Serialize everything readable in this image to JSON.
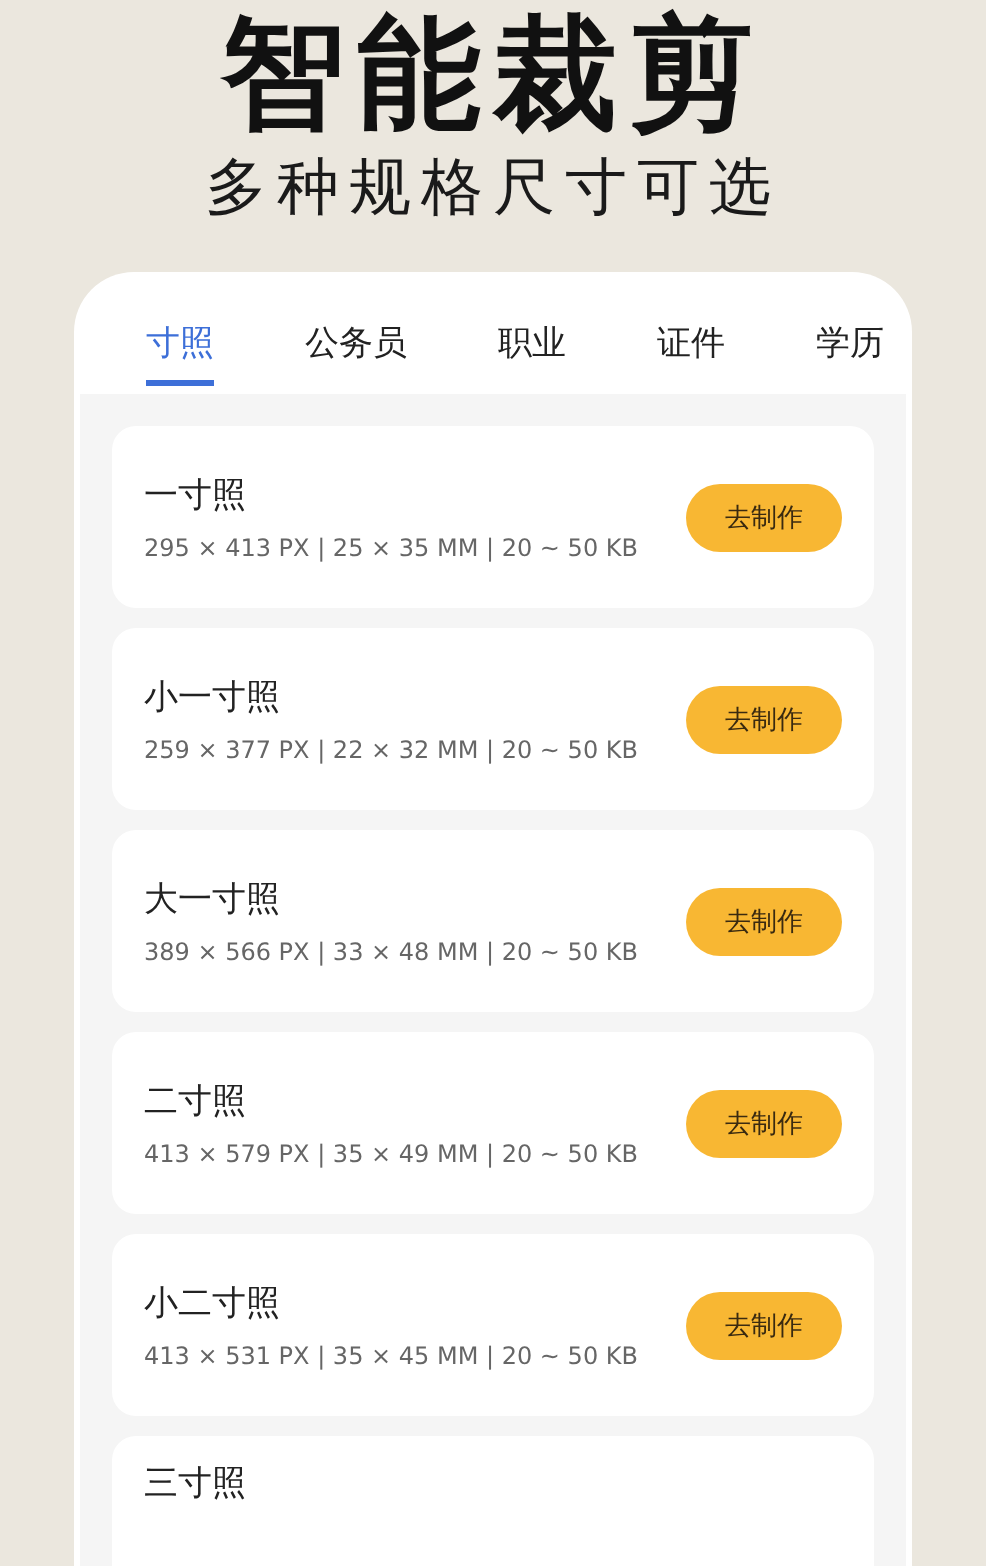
{
  "headline": "智能裁剪",
  "subheadline": "多种规格尺寸可选",
  "tabs": [
    {
      "label": "寸照",
      "selected": true
    },
    {
      "label": "公务员",
      "selected": false
    },
    {
      "label": "职业",
      "selected": false
    },
    {
      "label": "证件",
      "selected": false
    },
    {
      "label": "学历",
      "selected": false
    }
  ],
  "sizes": [
    {
      "name": "一寸照",
      "spec": "295 × 413 PX | 25 × 35 MM | 20 ~ 50 KB",
      "button": "去制作"
    },
    {
      "name": "小一寸照",
      "spec": "259 × 377 PX | 22 × 32 MM | 20 ~ 50 KB",
      "button": "去制作"
    },
    {
      "name": "大一寸照",
      "spec": "389 × 566 PX | 33 × 48 MM | 20 ~ 50 KB",
      "button": "去制作"
    },
    {
      "name": "二寸照",
      "spec": "413 × 579 PX | 35 × 49 MM | 20 ~ 50 KB",
      "button": "去制作"
    },
    {
      "name": "小二寸照",
      "spec": "413 × 531 PX | 35 × 45 MM | 20 ~ 50 KB",
      "button": "去制作"
    },
    {
      "name": "三寸照"
    }
  ]
}
